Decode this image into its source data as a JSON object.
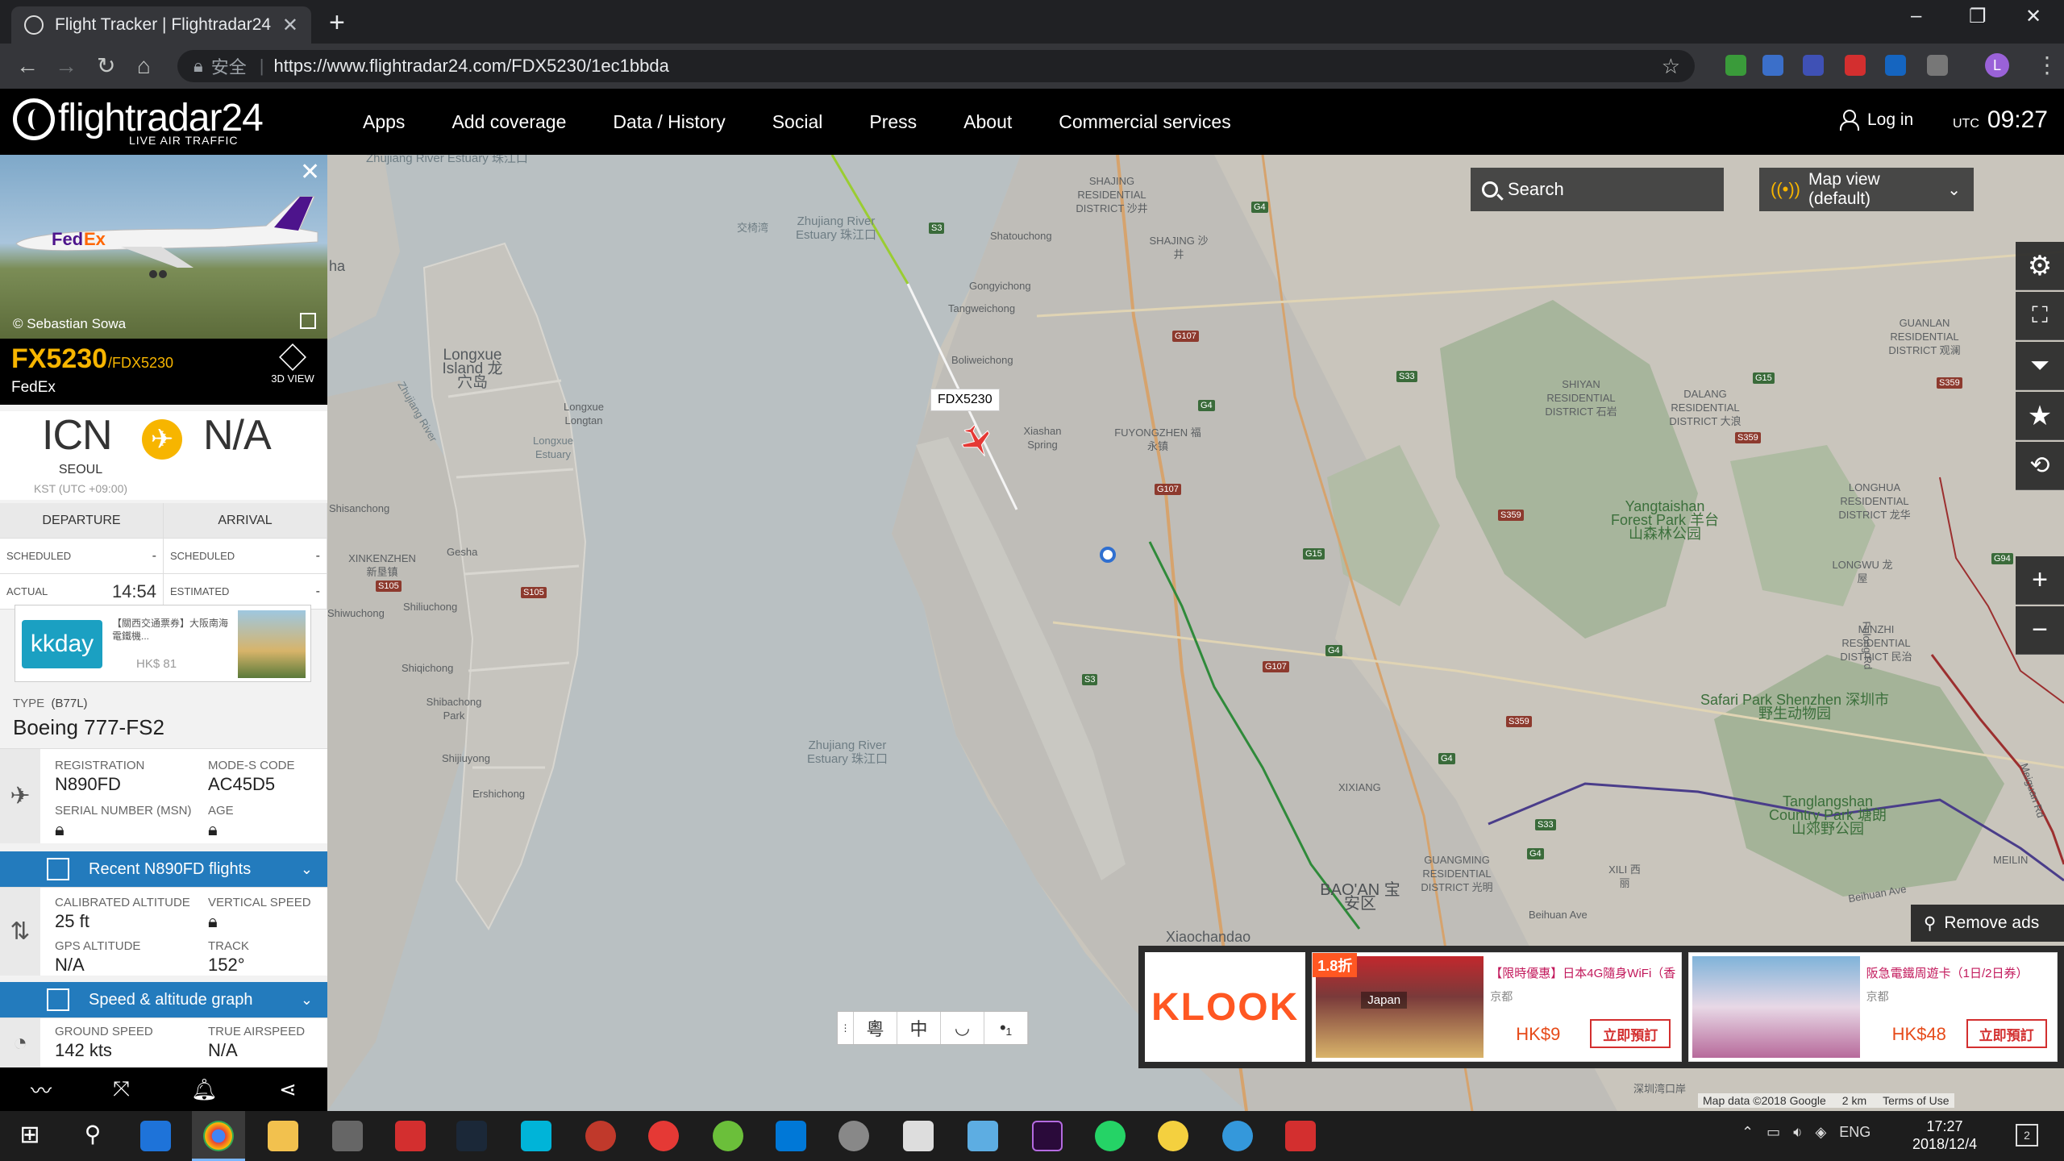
{
  "browser": {
    "tab_title": "Flight Tracker | Flightradar24 | ",
    "url_secure_label": "安全",
    "url": "https://www.flightradar24.com/FDX5230/1ec1bbda",
    "new_tab": "+",
    "profile_initial": "L",
    "window_controls": [
      "–",
      "❐",
      "✕"
    ]
  },
  "site": {
    "logo": "flightradar24",
    "logo_sub": "LIVE AIR TRAFFIC",
    "nav": [
      "Apps",
      "Add coverage",
      "Data / History",
      "Social",
      "Press",
      "About",
      "Commercial services"
    ],
    "login": "Log in",
    "utc_label": "UTC",
    "utc_time": "09:27"
  },
  "panel": {
    "photo_credit": "© Sebastian Sowa",
    "callsign": "FX5230",
    "callsign_icao": "/FDX5230",
    "airline": "FedEx",
    "view3d": "3D VIEW",
    "origin_code": "ICN",
    "origin_city": "SEOUL",
    "origin_tz": "KST (UTC +09:00)",
    "dest_code": "N/A",
    "departure_label": "DEPARTURE",
    "arrival_label": "ARRIVAL",
    "scheduled_label": "SCHEDULED",
    "scheduled_dep": "-",
    "scheduled_arr": "-",
    "actual_label": "ACTUAL",
    "actual_dep": "14:54",
    "estimated_label": "ESTIMATED",
    "estimated_arr": "-",
    "ad_kk_logo": "kkday",
    "ad_kk_title": "【關西交通票券】大阪南海電鐵機...",
    "ad_kk_price": "HK$ 81",
    "type_label": "TYPE",
    "type_code": "(B77L)",
    "aircraft": "Boeing 777-FS2",
    "registration_label": "REGISTRATION",
    "registration": "N890FD",
    "modes_label": "MODE-S CODE",
    "modes": "AC45D5",
    "serial_label": "SERIAL NUMBER (MSN)",
    "age_label": "AGE",
    "recent_flights": "Recent N890FD flights",
    "cal_alt_label": "CALIBRATED ALTITUDE",
    "cal_alt": "25 ft",
    "vspeed_label": "VERTICAL SPEED",
    "gps_alt_label": "GPS ALTITUDE",
    "gps_alt": "N/A",
    "track_label": "TRACK",
    "track": "152°",
    "speed_graph": "Speed & altitude graph",
    "ground_speed_label": "GROUND SPEED",
    "ground_speed": "142 kts",
    "tas_label": "TRUE AIRSPEED",
    "tas": "N/A"
  },
  "map": {
    "search": "Search",
    "map_view": "Map view (default)",
    "flight_label": "FDX5230",
    "remove_ads": "Remove ads",
    "lang_buttons": [
      "粵",
      "中",
      "◡",
      "•₁"
    ],
    "footer_data": "Map data ©2018 Google",
    "footer_scale": "2 km",
    "footer_terms": "Terms of Use",
    "labels": [
      {
        "text": "Zhujiang River Estuary 珠江口",
        "cls": "water"
      },
      {
        "text": "交椅湾",
        "cls": "water small"
      },
      {
        "text": "Zhujiang River Estuary 珠江口",
        "cls": "water"
      },
      {
        "text": "Longxue Island 龙穴岛",
        "cls": ""
      },
      {
        "text": "Longxue Longtan",
        "cls": "small"
      },
      {
        "text": "Longxue Estuary",
        "cls": "small water"
      },
      {
        "text": "Zhujiang River",
        "cls": "small water"
      },
      {
        "text": "Shisanchong",
        "cls": "small"
      },
      {
        "text": "XINKENZHEN 新垦镇",
        "cls": "small"
      },
      {
        "text": "Gesha",
        "cls": "small"
      },
      {
        "text": "Shiliuchong",
        "cls": "small"
      },
      {
        "text": "Shiwuchong",
        "cls": "small"
      },
      {
        "text": "Shiqichong",
        "cls": "small"
      },
      {
        "text": "Shibachong Park",
        "cls": "small"
      },
      {
        "text": "Shijiuyong",
        "cls": "small"
      },
      {
        "text": "Ershichong",
        "cls": "small"
      },
      {
        "text": "Zhujiang River Estuary 珠江口",
        "cls": "water"
      },
      {
        "text": "SHAJING RESIDENTIAL DISTRICT 沙井",
        "cls": "small"
      },
      {
        "text": "SHAJING 沙井",
        "cls": "small"
      },
      {
        "text": "Shatouchong",
        "cls": "small"
      },
      {
        "text": "Gongyichong",
        "cls": "small"
      },
      {
        "text": "Tangweichong",
        "cls": "small"
      },
      {
        "text": "Boliweichong",
        "cls": "small"
      },
      {
        "text": "Xiashan Spring",
        "cls": "small"
      },
      {
        "text": "FUYONGZHEN 福永镇",
        "cls": "small"
      },
      {
        "text": "SHIYAN RESIDENTIAL DISTRICT 石岩",
        "cls": "small"
      },
      {
        "text": "DALANG RESIDENTIAL DISTRICT 大浪",
        "cls": "small"
      },
      {
        "text": "GUANLAN RESIDENTIAL DISTRICT 观澜",
        "cls": "small"
      },
      {
        "text": "Yangtaishan Forest Park 羊台山森林公园",
        "cls": "green"
      },
      {
        "text": "LONGHUA RESIDENTIAL DISTRICT 龙华",
        "cls": "small"
      },
      {
        "text": "LONGWU 龙屋",
        "cls": "small"
      },
      {
        "text": "MINZHI RESIDENTIAL DISTRICT 民治",
        "cls": "small"
      },
      {
        "text": "Safari Park Shenzhen 深圳市野生动物园",
        "cls": "green"
      },
      {
        "text": "Tanglangshan Country Park 塘朗山郊野公园",
        "cls": "green"
      },
      {
        "text": "XIXIANG",
        "cls": "small"
      },
      {
        "text": "GUANGMING RESIDENTIAL DISTRICT 光明",
        "cls": "small"
      },
      {
        "text": "BAO'AN 宝安区",
        "cls": "big"
      },
      {
        "text": "XILI 西丽",
        "cls": "small"
      },
      {
        "text": "Beihuan Ave",
        "cls": "small"
      },
      {
        "text": "Xiaochandao",
        "cls": ""
      },
      {
        "text": "MEILIN",
        "cls": "small"
      },
      {
        "text": "Beihuan Ave",
        "cls": "small"
      },
      {
        "text": "Fulong Rd",
        "cls": "small"
      },
      {
        "text": "Meiguan Rd",
        "cls": "small"
      },
      {
        "text": "深圳湾口岸",
        "cls": "small"
      },
      {
        "text": "ha",
        "cls": ""
      }
    ]
  },
  "ads": {
    "klook": "KLOOK",
    "card1_badge": "1.8折",
    "card1_title": "【限時優惠】日本4G隨身WiFi（香...",
    "card1_loc": "京都",
    "card1_img_text": "Japan",
    "card1_price": "HK$9",
    "card1_btn": "立即預訂",
    "card2_title": "阪急電鐵周遊卡（1日/2日券）",
    "card2_loc": "京都",
    "card2_price": "HK$48",
    "card2_btn": "立即預訂"
  },
  "taskbar": {
    "lang": "ENG",
    "time": "17:27",
    "date": "2018/12/4",
    "notif_count": "2"
  },
  "colors": {
    "brand_yellow": "#f7b500",
    "blue_bar": "#237bbd",
    "header_bg": "#000000"
  }
}
